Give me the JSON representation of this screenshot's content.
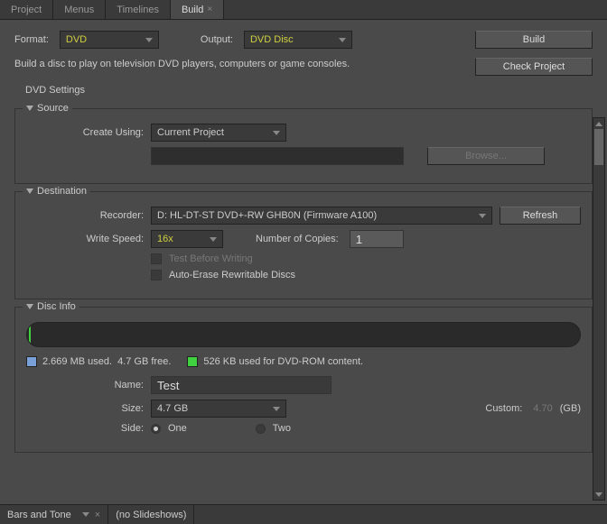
{
  "tabs": {
    "project": "Project",
    "menus": "Menus",
    "timelines": "Timelines",
    "build": "Build"
  },
  "top": {
    "format_label": "Format:",
    "format_value": "DVD",
    "output_label": "Output:",
    "output_value": "DVD Disc",
    "build_btn": "Build",
    "check_btn": "Check Project",
    "helper": "Build a disc to play on television DVD players, computers or game consoles."
  },
  "settings_title": "DVD Settings",
  "source": {
    "title": "Source",
    "create_label": "Create Using:",
    "create_value": "Current Project",
    "browse": "Browse..."
  },
  "destination": {
    "title": "Destination",
    "recorder_label": "Recorder:",
    "recorder_value": "D: HL-DT-ST DVD+-RW GHB0N (Firmware A100)",
    "refresh": "Refresh",
    "speed_label": "Write Speed:",
    "speed_value": "16x",
    "copies_label": "Number of Copies:",
    "copies_value": "1",
    "test_label": "Test Before Writing",
    "erase_label": "Auto-Erase Rewritable Discs"
  },
  "disc": {
    "title": "Disc Info",
    "used": "2.669 MB used.",
    "free": "4.7 GB free.",
    "rom": "526 KB used for DVD-ROM content.",
    "name_label": "Name:",
    "name_value": "Test",
    "size_label": "Size:",
    "size_value": "4.7 GB",
    "custom_label": "Custom:",
    "custom_value": "4.70",
    "custom_unit": "(GB)",
    "side_label": "Side:",
    "side_one": "One",
    "side_two": "Two"
  },
  "footer": {
    "bars": "Bars and Tone",
    "noslide": "(no Slideshows)"
  }
}
